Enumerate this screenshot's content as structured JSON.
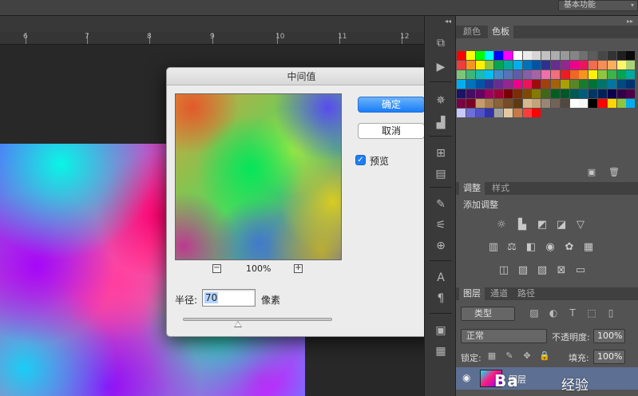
{
  "topbar": {
    "workspace": "基本功能"
  },
  "ruler": {
    "marks": [
      "6",
      "7",
      "8",
      "9",
      "10",
      "11",
      "12"
    ]
  },
  "dialog": {
    "title": "中间值",
    "ok_label": "确定",
    "cancel_label": "取消",
    "preview_label": "预览",
    "preview_checked": true,
    "zoom": "100%",
    "zoom_out": "−",
    "zoom_in": "+",
    "radius_label": "半径:",
    "radius_value": "70",
    "units_label": "像素",
    "slider_level": 0.37
  },
  "color_panel": {
    "tabs": [
      "颜色",
      "色板"
    ],
    "active_tab": "色板",
    "swatch_rows": [
      [
        "#ff0000",
        "#ffff00",
        "#00ff00",
        "#00ffff",
        "#0000ff",
        "#ff00ff",
        "#ffffff",
        "#ebebeb",
        "#d6d6d6",
        "#c2c2c2",
        "#adadad",
        "#999999",
        "#858585",
        "#707070",
        "#5c5c5c",
        "#474747",
        "#333333",
        "#1f1f1f",
        "#0a0a0a"
      ],
      [
        "#f03c3c",
        "#f7941d",
        "#fff200",
        "#8dc63f",
        "#00a651",
        "#00a99d",
        "#00aeef",
        "#0072bc",
        "#0054a6",
        "#2e3192",
        "#662d91",
        "#92278f",
        "#ec008c",
        "#ed145b",
        "#f26c4f",
        "#f68e56",
        "#fbaf5d",
        "#fff568",
        "#acd373"
      ],
      [
        "#7cc576",
        "#3bb878",
        "#1abbb4",
        "#00bff3",
        "#438ccb",
        "#5574b9",
        "#605ca8",
        "#855fa8",
        "#a763a8",
        "#f06eaa",
        "#f26d7d",
        "#ed1c24",
        "#f26522",
        "#f7941d",
        "#fff200",
        "#8dc63f",
        "#39b54a",
        "#00a651",
        "#00a99d"
      ],
      [
        "#00aeef",
        "#0072bc",
        "#0054a6",
        "#2e3192",
        "#662d91",
        "#92278f",
        "#ec008c",
        "#ed145b",
        "#9e0b0f",
        "#a0410d",
        "#a36209",
        "#aba000",
        "#598527",
        "#1a7b30",
        "#007236",
        "#00746b",
        "#0076a3",
        "#004a80",
        "#003471"
      ],
      [
        "#1b1464",
        "#440e62",
        "#630460",
        "#9e005d",
        "#9e0039",
        "#790000",
        "#7b2e00",
        "#7d4900",
        "#827b00",
        "#406618",
        "#005e20",
        "#005826",
        "#005952",
        "#005b7f",
        "#003663",
        "#002157",
        "#0d004c",
        "#32004b",
        "#4b0049"
      ],
      [
        "#7b0046",
        "#7a0026",
        "#c69c6d",
        "#a67c52",
        "#8c6239",
        "#754c24",
        "#603913",
        "#d7b98e",
        "#c4a27a",
        "#998675",
        "#736357",
        "#534741",
        "#ffffff",
        "#f7f7f7",
        "#000000",
        "#ff0000",
        "#ffd700",
        "#8dc63f",
        "#00aeef"
      ],
      [
        "#c8c8ff",
        "#6e6edc",
        "#5050c8",
        "#3232aa",
        "#a0a0a0",
        "#e6c8a0",
        "#c87846",
        "#ff3c3c",
        "#ff0000"
      ]
    ]
  },
  "adjust_panel": {
    "tabs": [
      "调整",
      "样式"
    ],
    "active_tab": "调整",
    "title": "添加调整"
  },
  "layers_panel": {
    "tabs": [
      "图层",
      "通道",
      "路径"
    ],
    "active_tab": "图层",
    "filter_label": "类型",
    "blend_mode": "正常",
    "opacity_label": "不透明度:",
    "opacity_value": "100%",
    "lock_label": "锁定:",
    "fill_label": "填充:",
    "fill_value": "100%",
    "layer_name": "图层"
  },
  "watermark": {
    "logo": "Ba",
    "text": "经验"
  }
}
